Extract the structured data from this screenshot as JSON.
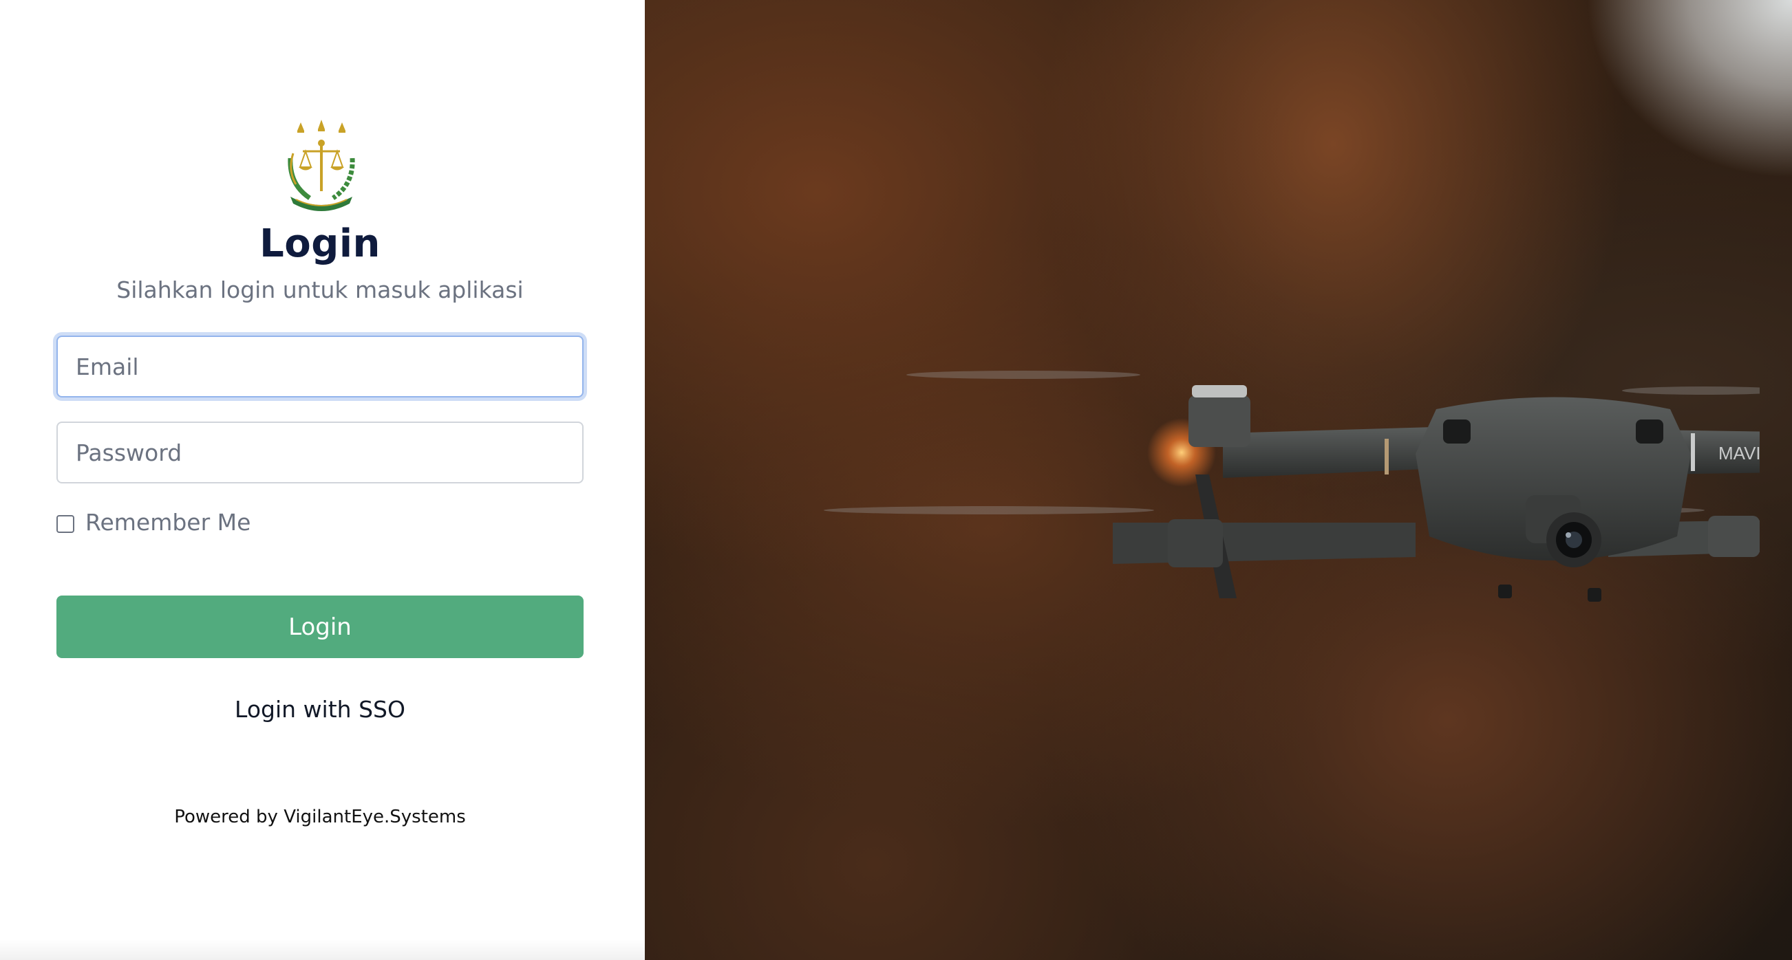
{
  "login": {
    "title": "Login",
    "subtitle": "Silahkan login untuk masuk aplikasi",
    "email_placeholder": "Email",
    "password_placeholder": "Password",
    "remember_label": "Remember Me",
    "remember_checked": false,
    "login_button": "Login",
    "sso_link": "Login with SSO",
    "powered_by": "Powered by VigilantEye.Systems",
    "logo_icon": "justice-emblem-icon"
  },
  "hero": {
    "image": "drone-photo",
    "drone_label": "MAVIC PRO"
  },
  "colors": {
    "accent": "#52ab7e",
    "title": "#0f1b3d",
    "focus_ring": "#93b4ec"
  }
}
